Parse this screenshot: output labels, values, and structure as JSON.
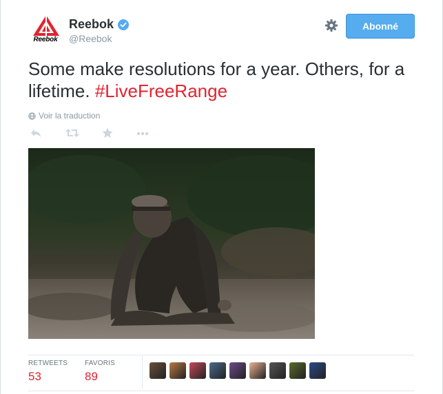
{
  "account": {
    "name": "Reebok",
    "handle": "@Reebok",
    "logo_text": "Reebok",
    "verified": true,
    "brand_color": "#e0242f"
  },
  "header": {
    "settings_icon": "gear-icon",
    "follow_label": "Abonné"
  },
  "tweet": {
    "text": "Some make resolutions for a year. Others, for a lifetime. ",
    "hashtag": "#LiveFreeRange",
    "translate_label": "Voir la traduction",
    "translate_icon": "globe-icon"
  },
  "actions": [
    {
      "name": "reply-icon"
    },
    {
      "name": "retweet-icon"
    },
    {
      "name": "favorite-star-icon"
    },
    {
      "name": "more-dots-icon"
    }
  ],
  "stats": {
    "retweets_label": "RETWEETS",
    "retweets_value": "53",
    "favorites_label": "FAVORIS",
    "favorites_value": "89"
  },
  "avatars": [
    {
      "color": "#6a4f3a"
    },
    {
      "color": "#b87945"
    },
    {
      "color": "#c24a5a"
    },
    {
      "color": "#4a6a8a"
    },
    {
      "color": "#6b4c8a"
    },
    {
      "color": "#e8b090"
    },
    {
      "color": "#555555"
    },
    {
      "color": "#5a6a2a"
    },
    {
      "color": "#2a4a8a"
    }
  ],
  "colors": {
    "accent": "#55acee",
    "hashtag": "#e0242f",
    "muted": "#8899a6"
  }
}
